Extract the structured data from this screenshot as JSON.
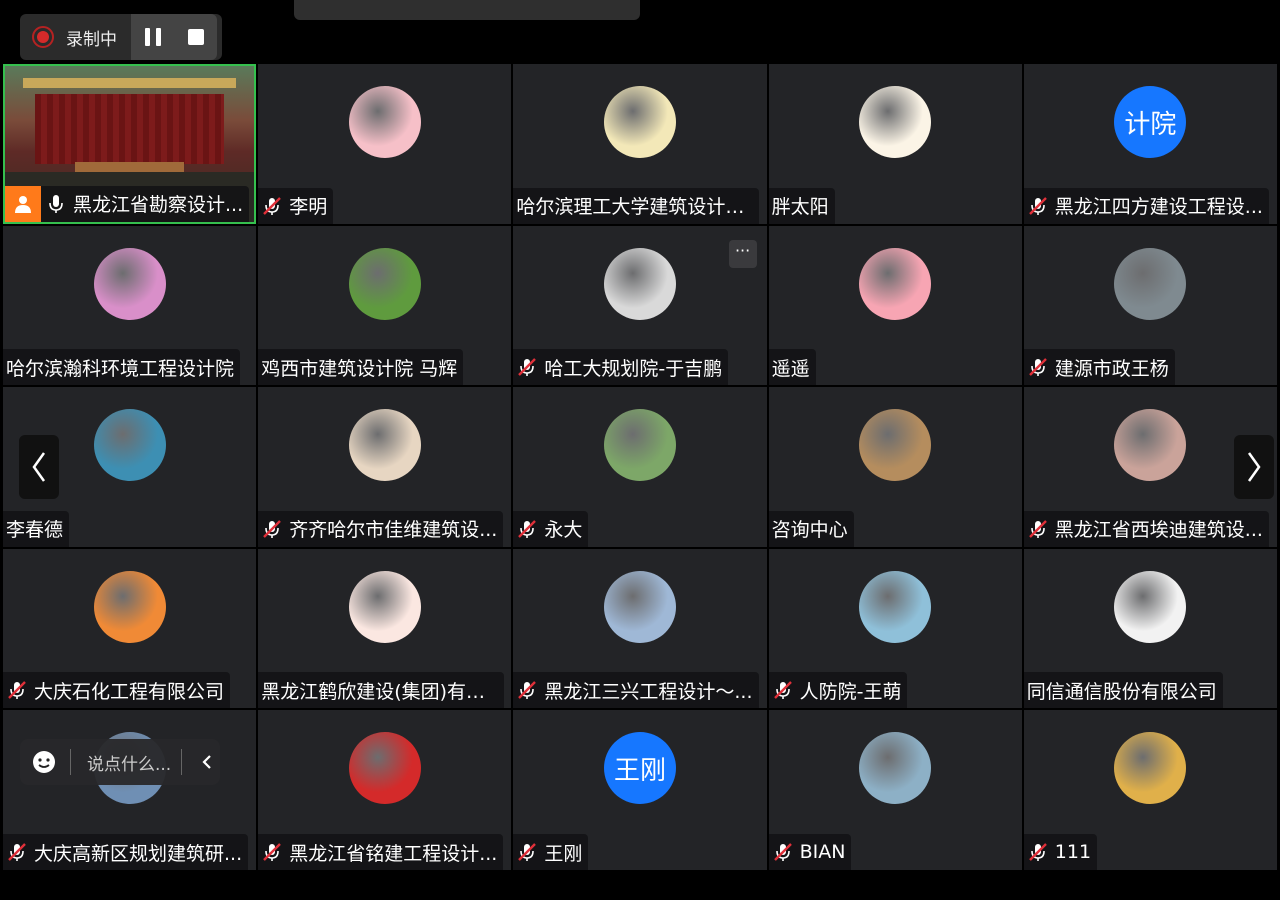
{
  "recording": {
    "label": "录制中"
  },
  "participants": [
    {
      "name": "黑龙江省勘察设计...",
      "muted": false,
      "avatar": "video",
      "active": true
    },
    {
      "name": "李明",
      "muted": true,
      "avatar": "pig-icon",
      "bg": "#f6c0c8"
    },
    {
      "name": "哈尔滨理工大学建筑设计研...",
      "muted": false,
      "avatar": "cartoon-icon",
      "bg": "#f3e8b8"
    },
    {
      "name": "胖太阳",
      "muted": false,
      "avatar": "sun-icon",
      "bg": "#fbf4e6"
    },
    {
      "name": "黑龙江四方建设工程设...",
      "muted": true,
      "avatar": "text",
      "text": "计院"
    },
    {
      "name": "哈尔滨瀚科环境工程设计院",
      "muted": false,
      "avatar": "flower-icon",
      "bg": "#d98fc9"
    },
    {
      "name": "鸡西市建筑设计院 马辉",
      "muted": false,
      "avatar": "grass-icon",
      "bg": "#5f9b3e"
    },
    {
      "name": "哈工大规划院-于吉鹏",
      "muted": true,
      "avatar": "sketch-icon",
      "bg": "#d9d9d9",
      "more": true
    },
    {
      "name": "遥遥",
      "muted": false,
      "avatar": "pig-icon",
      "bg": "#f7a5b3"
    },
    {
      "name": "建源市政王杨",
      "muted": true,
      "avatar": "photo-icon",
      "bg": "#7f8a90"
    },
    {
      "name": "李春德",
      "muted": false,
      "avatar": "photo-icon",
      "bg": "#3d8fb3"
    },
    {
      "name": "齐齐哈尔市佳维建筑设...",
      "muted": true,
      "avatar": "portrait-icon",
      "bg": "#e7d6c2"
    },
    {
      "name": "永大",
      "muted": true,
      "avatar": "landscape-icon",
      "bg": "#7da768"
    },
    {
      "name": "咨询中心",
      "muted": false,
      "avatar": "field-icon",
      "bg": "#b58d5e"
    },
    {
      "name": "黑龙江省西埃迪建筑设...",
      "muted": true,
      "avatar": "woman-icon",
      "bg": "#caa39a"
    },
    {
      "name": "大庆石化工程有限公司",
      "muted": true,
      "avatar": "tiger-icon",
      "bg": "#f08a36"
    },
    {
      "name": "黑龙江鹤欣建设(集团)有限...",
      "muted": false,
      "avatar": "boy-icon",
      "bg": "#fbe7e1"
    },
    {
      "name": "黑龙江三兴工程设计～...",
      "muted": true,
      "avatar": "building-icon",
      "bg": "#9fb8d6"
    },
    {
      "name": "人防院-王萌",
      "muted": true,
      "avatar": "photo-icon",
      "bg": "#8fc0d9"
    },
    {
      "name": "同信通信股份有限公司",
      "muted": false,
      "avatar": "family-icon",
      "bg": "#f2f2f2"
    },
    {
      "name": "大庆高新区规划建筑研...",
      "muted": true,
      "avatar": "photo-icon",
      "bg": "#6f8fb4"
    },
    {
      "name": "黑龙江省铭建工程设计...",
      "muted": true,
      "avatar": "girl-icon",
      "bg": "#d42a2a"
    },
    {
      "name": "王刚",
      "muted": true,
      "avatar": "text",
      "text": "王刚"
    },
    {
      "name": "BIAN",
      "muted": true,
      "avatar": "lake-icon",
      "bg": "#8db0c6"
    },
    {
      "name": "111",
      "muted": true,
      "avatar": "wheat-icon",
      "bg": "#e0b04a"
    }
  ],
  "chat": {
    "placeholder": "说点什么..."
  }
}
